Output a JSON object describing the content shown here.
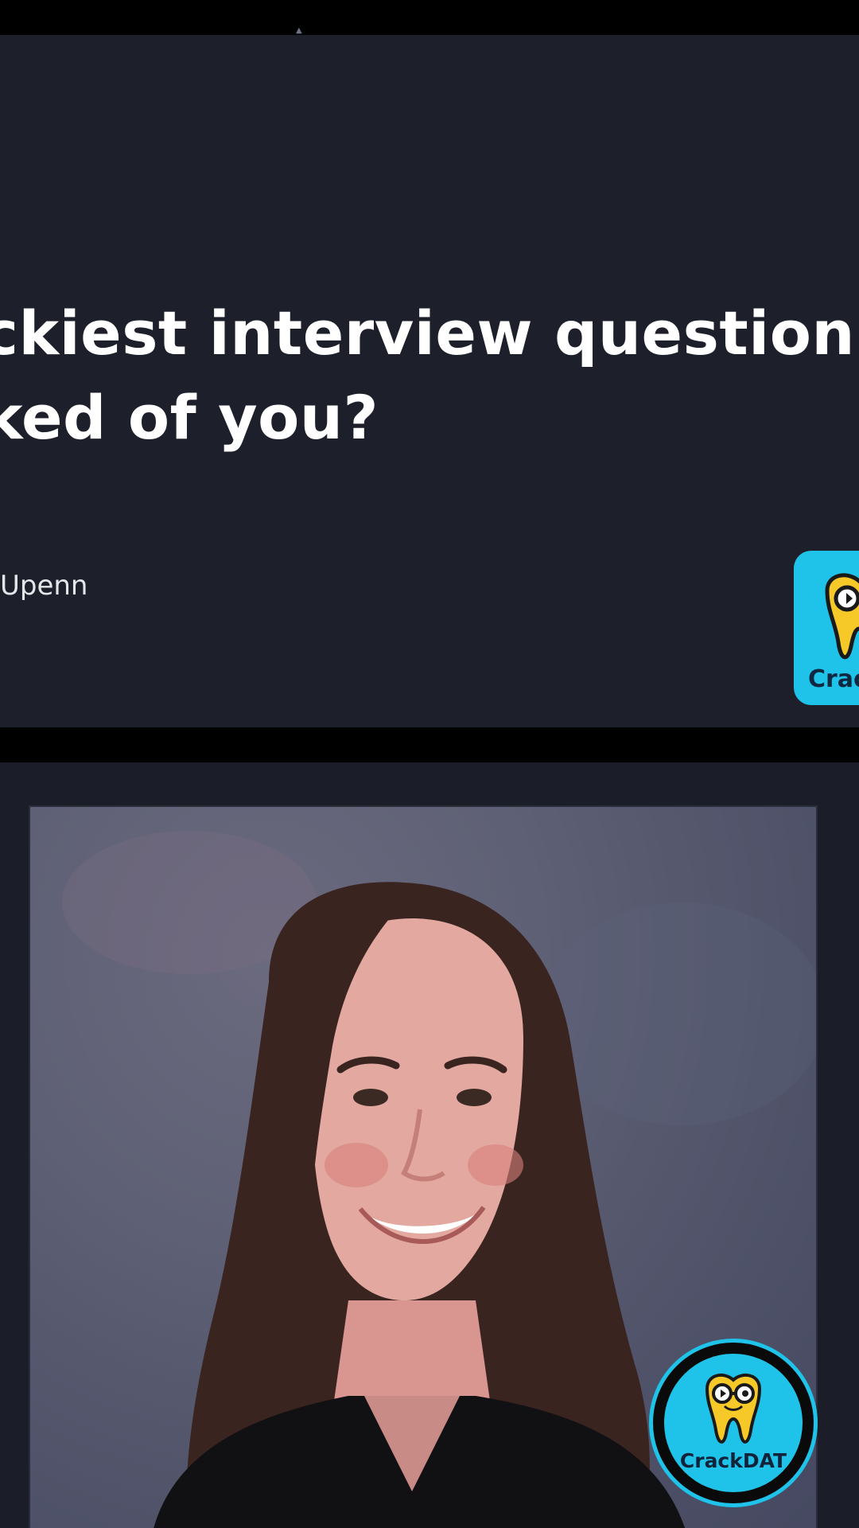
{
  "slide": {
    "title_line1": "ckiest interview question",
    "title_line2": "ked of you?",
    "subtitle": "Upenn",
    "logo_label": "Crac"
  },
  "overlay_logo": {
    "label": "CrackDAT",
    "icon": "tooth-with-glasses-icon",
    "accent_color": "#1fc2e8"
  },
  "colors": {
    "slide_background": "#1d202b",
    "title_text": "#ffffff",
    "brand_cyan": "#1fc2e8"
  }
}
